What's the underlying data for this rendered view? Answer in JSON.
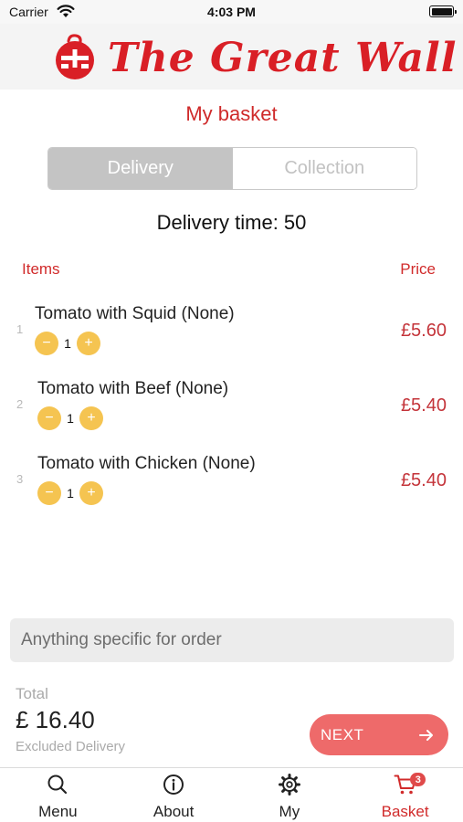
{
  "status_bar": {
    "carrier": "Carrier",
    "time": "4:03 PM"
  },
  "header": {
    "logo_text": "The Great Wall"
  },
  "page_title": "My basket",
  "mode_toggle": {
    "options": [
      "Delivery",
      "Collection"
    ],
    "selected": "Delivery"
  },
  "delivery_time": "Delivery time: 50",
  "table": {
    "items_header": "Items",
    "price_header": "Price"
  },
  "items": [
    {
      "index": "1",
      "name": "Tomato with Squid (None)",
      "quantity": "1",
      "price": "£5.60",
      "minus": "−",
      "plus": "+"
    },
    {
      "index": "2",
      "name": "Tomato with Beef (None)",
      "quantity": "1",
      "price": "£5.40",
      "minus": "−",
      "plus": "+"
    },
    {
      "index": "3",
      "name": "Tomato with Chicken (None)",
      "quantity": "1",
      "price": "£5.40",
      "minus": "−",
      "plus": "+"
    }
  ],
  "note": {
    "placeholder": "Anything specific for order",
    "value": ""
  },
  "summary": {
    "total_label": "Total",
    "total_value": "£ 16.40",
    "excluded_note": "Excluded Delivery"
  },
  "next_button": {
    "label": "NEXT"
  },
  "tab_bar": {
    "tabs": [
      {
        "label": "Menu",
        "icon": "search-icon"
      },
      {
        "label": "About",
        "icon": "info-icon"
      },
      {
        "label": "My",
        "icon": "gear-icon"
      },
      {
        "label": "Basket",
        "icon": "cart-icon",
        "badge": "3",
        "active": true
      }
    ]
  },
  "colors": {
    "brand_red": "#d91f26",
    "accent_red": "#d12b2b",
    "price_red": "#c4343a",
    "stepper_yellow": "#f5c451",
    "next_button": "#ee6a6a",
    "segment_active": "#c4c4c4"
  }
}
